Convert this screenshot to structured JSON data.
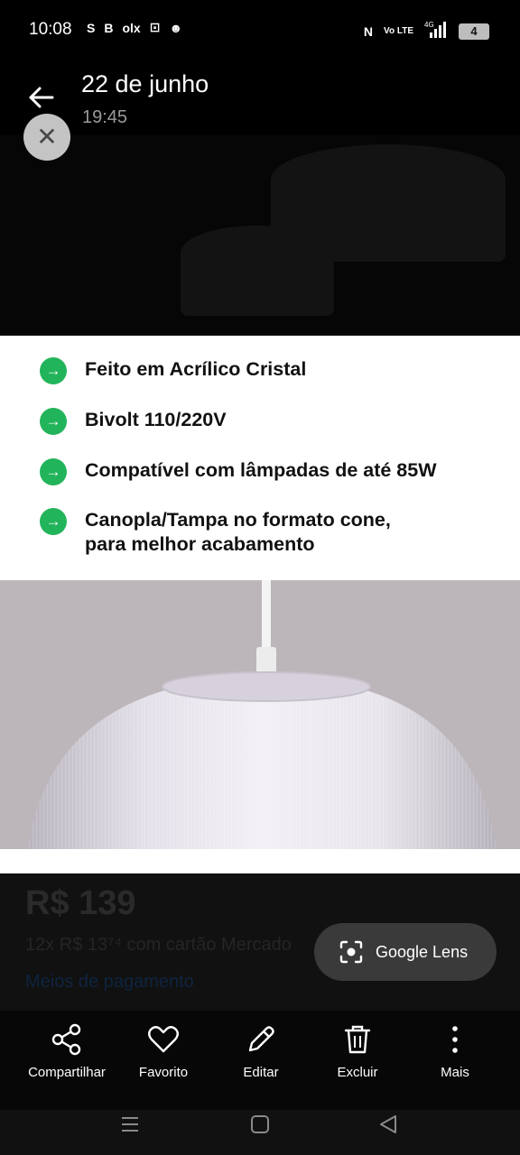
{
  "status_bar": {
    "time": "10:08",
    "left_icons": [
      "S",
      "B",
      "olx",
      "⊡",
      "☻"
    ],
    "right_icons": [
      "N",
      "Vo LTE",
      "4G"
    ],
    "battery": "4"
  },
  "header": {
    "title": "22 de junho",
    "subtitle": "19:45"
  },
  "features": {
    "items": [
      {
        "text": "Feito em Acrílico Cristal"
      },
      {
        "text": "Bivolt 110/220V"
      },
      {
        "text": "Compatível com lâmpadas de até 85W"
      },
      {
        "text": "Canopla/Tampa no formato cone,\npara melhor acabamento"
      }
    ],
    "icon": "arrow-right-icon",
    "icon_color": "#22b45a"
  },
  "product": {
    "price": "R$ 139",
    "installments": "12x R$ 13⁷⁴ com cartão Mercado",
    "payment_link": "Meios de pagamento"
  },
  "lens": {
    "label": "Google Lens"
  },
  "actions": [
    {
      "label": "Compartilhar",
      "icon": "share-icon"
    },
    {
      "label": "Favorito",
      "icon": "heart-icon"
    },
    {
      "label": "Editar",
      "icon": "pencil-icon"
    },
    {
      "label": "Excluir",
      "icon": "trash-icon"
    },
    {
      "label": "Mais",
      "icon": "more-vertical-icon"
    }
  ],
  "colors": {
    "accent_green": "#22b45a",
    "lens_pill": "#3a3a3a"
  }
}
